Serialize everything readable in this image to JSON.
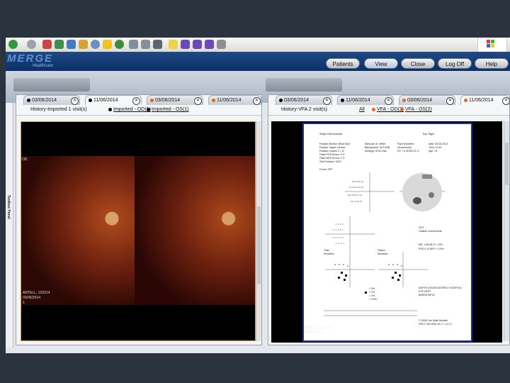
{
  "toolbar": {
    "icons": [
      "back-icon",
      "forward-icon",
      "page-icon",
      "page-icon",
      "refresh-icon",
      "home-icon",
      "search-icon",
      "favorites-icon",
      "history-icon",
      "mail-icon",
      "print-icon",
      "edit-icon",
      "folder-icon",
      "note-icon",
      "note-icon",
      "note-icon",
      "screen-icon"
    ]
  },
  "brand": {
    "logo_text": "MERGE",
    "sub_text": "Healthcare"
  },
  "nav": {
    "buttons": [
      "Patients",
      "View",
      "Close",
      "Log Off",
      "Help"
    ]
  },
  "toolbox": {
    "label": "Toolbox Panel"
  },
  "left_panel": {
    "tabs": [
      "03/06/2014",
      "11/06/2014",
      "03/06/2014",
      "11/06/2014"
    ],
    "history_label": "History-Imported 1 visit(s)",
    "filters": [
      "Imported - OD(1)",
      "Imported - OS(1)"
    ],
    "image_label_eye": "OD",
    "image_caption": [
      "ANTELL, 120314",
      "03/06/2014",
      "1"
    ]
  },
  "right_panel": {
    "tabs": [
      "03/06/2014",
      "11/06/2014",
      "03/06/2014",
      "11/06/2014"
    ],
    "history_label": "History-VFA 2 visit(s)",
    "filters": [
      "All",
      "VFA - OD(2)",
      "VFA - OS(2)"
    ],
    "report_caption": [
      "ANTELL, 120314",
      "03/06/2014",
      "1"
    ],
    "report": {
      "title": "Single Field Analysis",
      "eye": "Eye: Right",
      "left_lines": [
        "Fixation Monitor: Blind Spot",
        "Fixation Target: Central",
        "Fixation Losses: 0 / 12",
        "False POS Errors: 0 %",
        "False NEG Errors: 2 %",
        "Test Duration: 03:57"
      ],
      "mid_lines": [
        "Stimulus: III, White",
        "Background: 31.5 ASB",
        "Strategy: SITA-Fast"
      ],
      "mid2_lines": [
        "Pupil Diameter:",
        "Visual Acuity:",
        "RX: +0.25 DS    DC  X"
      ],
      "right_lines": [
        "Date: 03-06-2014",
        "Time: 10:44",
        "Age: 76"
      ],
      "fovea": "Fovea: OFF",
      "ght_label": "GHT",
      "ght_value": "Outside normal limits",
      "md": "MD    -1.68 dB  P < 10%",
      "psd": "PSD   4.13 dB  P < 0.5%",
      "total_dev": "Total Deviation",
      "pattern_dev": "Pattern Deviation",
      "legend": [
        "< 5%",
        "< 2%",
        "< 1%",
        "< 0.5%"
      ],
      "hospital": [
        "NORTH DEVON DISTRICT HOSPITAL",
        "EYE DEPT",
        "BARNSTAPLE"
      ],
      "footer": [
        "© 2008 Carl Zeiss Meditec",
        "HFA II 750-0000-16.2 / 1.4.2.1"
      ]
    }
  }
}
